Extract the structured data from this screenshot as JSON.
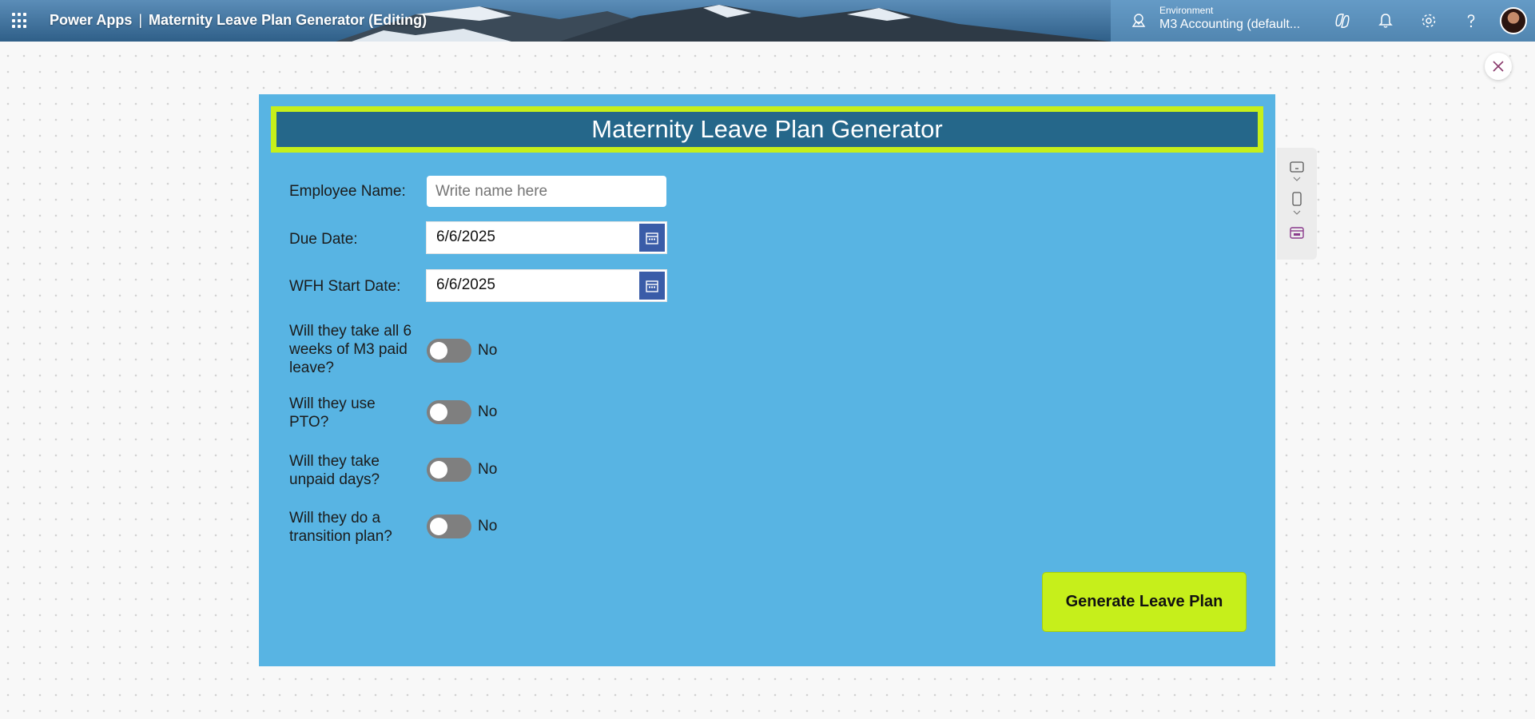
{
  "topbar": {
    "product": "Power Apps",
    "separator": "|",
    "app_title": "Maternity Leave Plan Generator (Editing)",
    "environment_label": "Environment",
    "environment_value": "M3 Accounting (default..."
  },
  "app": {
    "title": "Maternity Leave Plan Generator",
    "employee_name_label": "Employee Name:",
    "employee_name_placeholder": "Write name here",
    "due_date_label": "Due Date:",
    "due_date_value": "6/6/2025",
    "wfh_start_label": "WFH Start Date:",
    "wfh_start_value": "6/6/2025",
    "questions": [
      {
        "label": "Will they take all 6 weeks of M3 paid leave?",
        "value": "No"
      },
      {
        "label": "Will they use PTO?",
        "value": "No"
      },
      {
        "label": "Will they take unpaid days?",
        "value": "No"
      },
      {
        "label": "Will they do a transition plan?",
        "value": "No"
      }
    ],
    "generate_button": "Generate Leave Plan"
  },
  "colors": {
    "canvas": "#58b4e3",
    "title_bar": "#25678a",
    "accent_lime": "#c6ef1b",
    "calendar_button": "#3a5ca8",
    "toggle_off": "#7f7f7f"
  },
  "icons": {
    "topbar": [
      "waffle-icon",
      "environment-icon",
      "copilot-icon",
      "bell-icon",
      "gear-icon",
      "help-icon",
      "avatar"
    ],
    "side_panel": [
      "tablet-icon",
      "phone-icon",
      "preview-icon"
    ],
    "close": "close-icon"
  }
}
